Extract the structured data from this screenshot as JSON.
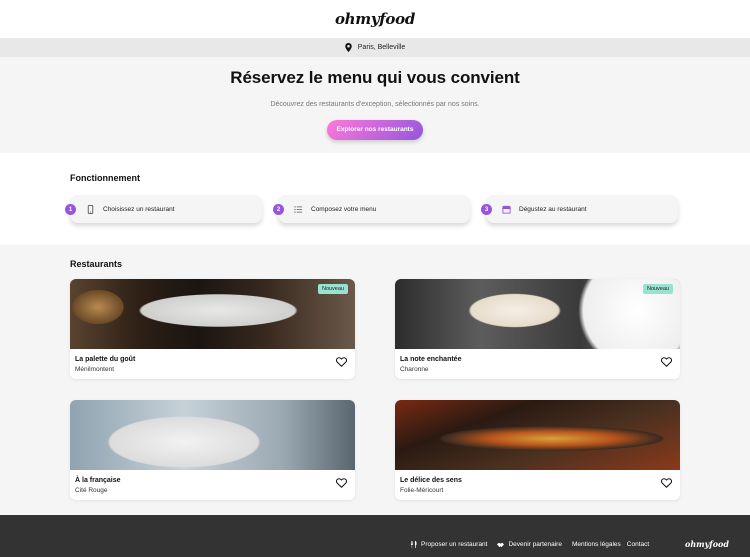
{
  "header": {
    "logo": "ohmyfood"
  },
  "location": {
    "text": "Paris, Belleville"
  },
  "hero": {
    "title": "Réservez le menu qui vous convient",
    "subtitle": "Découvrez des restaurants d'exception, sélectionnés par nos soins.",
    "cta_label": "Explorer nos restaurants"
  },
  "howto": {
    "title": "Fonctionnement",
    "steps": [
      {
        "number": "1",
        "icon": "mobile-phone-icon",
        "label": "Choisissez un restaurant"
      },
      {
        "number": "2",
        "icon": "list-icon",
        "label": "Composez votre menu"
      },
      {
        "number": "3",
        "icon": "store-icon",
        "label": "Dégustez au restaurant"
      }
    ]
  },
  "restaurants": {
    "title": "Restaurants",
    "items": [
      {
        "name": "La palette du goût",
        "area": "Ménilmontent",
        "badge": "Nouveau"
      },
      {
        "name": "La note enchantée",
        "area": "Charonne",
        "badge": "Nouveau"
      },
      {
        "name": "À la française",
        "area": "Cité Rouge",
        "badge": ""
      },
      {
        "name": "Le délice des sens",
        "area": "Folie-Méricourt",
        "badge": ""
      }
    ]
  },
  "footer": {
    "links": [
      "Proposer un restaurant",
      "Devenir partenaire"
    ],
    "legal": [
      "Mentions légales",
      "Contact"
    ],
    "logo": "ohmyfood"
  },
  "colors": {
    "accent_start": "#ff79da",
    "accent_end": "#9356dc",
    "badge": "#99e2d0",
    "footer": "#333333"
  }
}
